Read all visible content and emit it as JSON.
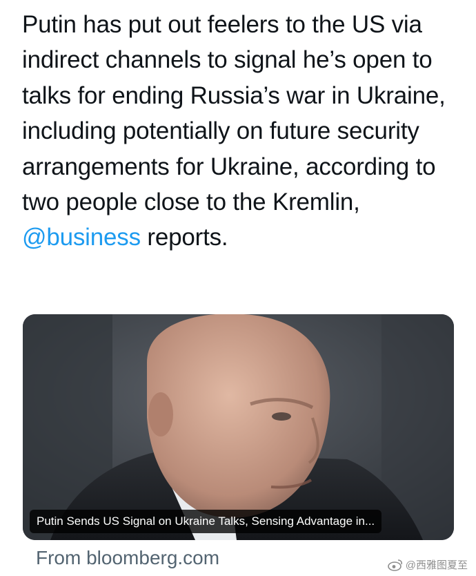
{
  "tweet": {
    "text_before": "Putin has put out feelers to the US via indirect channels to signal he’s open to talks for ending Russia’s war in Ukraine, including potentially on future security arrangements for Ukraine, according to two people close to the Kremlin, ",
    "mention": "@business",
    "text_after": " reports."
  },
  "link_card": {
    "headline": "Putin Sends US Signal on Ukraine Talks, Sensing Advantage in...",
    "source": "From bloomberg.com"
  },
  "watermark": {
    "text": "@西雅图夏至",
    "icon": "weibo-icon"
  },
  "colors": {
    "text": "#0f1419",
    "mention": "#1d9bf0",
    "source": "#536471"
  }
}
